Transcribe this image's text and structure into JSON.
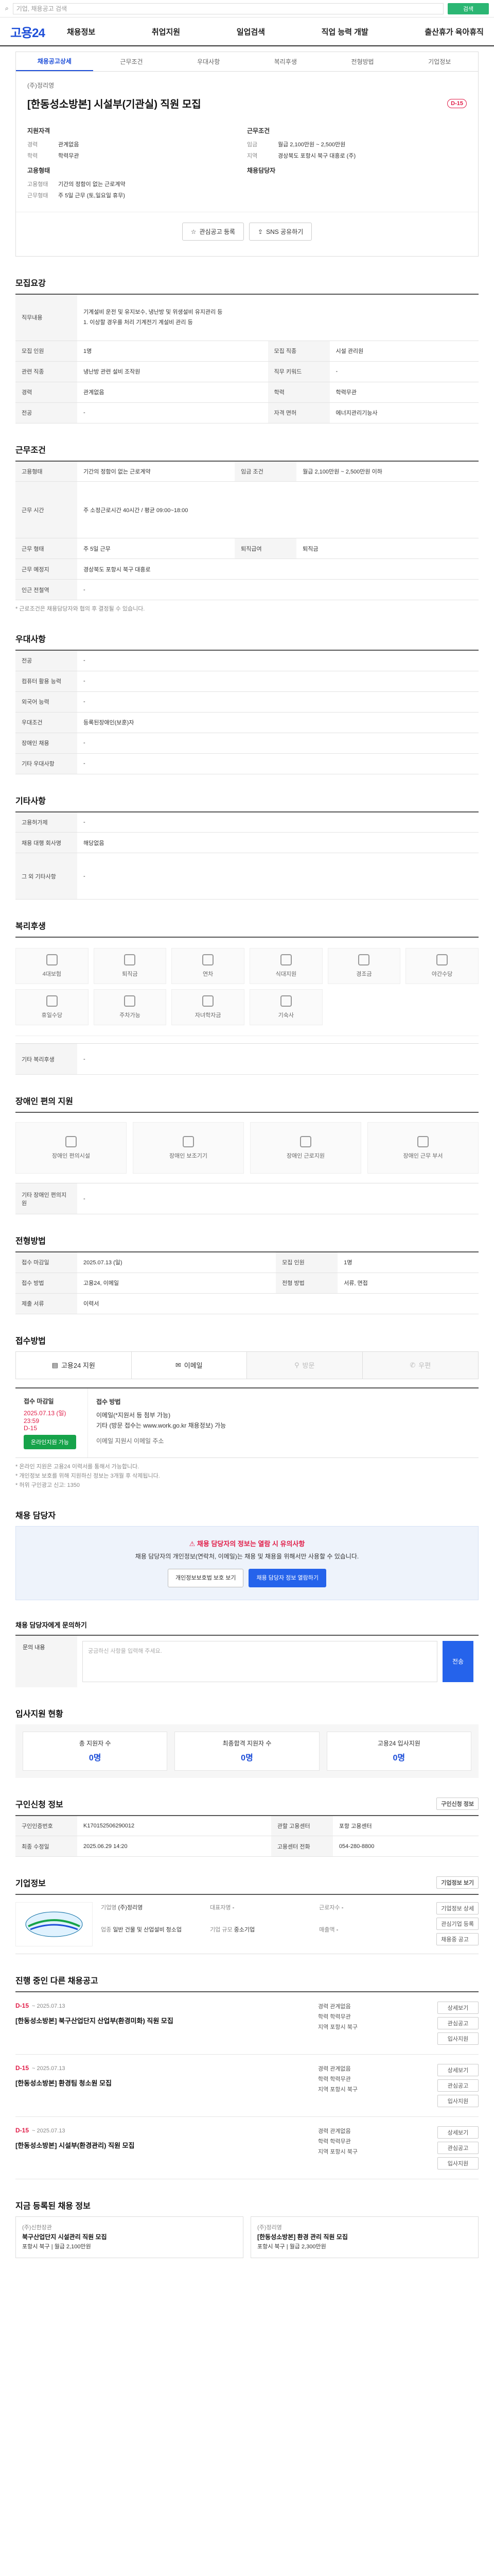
{
  "search": {
    "placeholder": "기업, 채용공고 검색",
    "button": "검색"
  },
  "gnb": {
    "logo": "고용24",
    "menu": [
      "채용정보",
      "취업지원",
      "일업검색",
      "직업 능력 개발",
      "출산휴가 육아휴직"
    ]
  },
  "tabs": [
    "채용공고상세",
    "근무조건",
    "우대사항",
    "복리후생",
    "전형방법",
    "기업정보"
  ],
  "title": {
    "company": "(주)정리영",
    "heading": "[한동성소방본] 시설부(기관실) 직원 모집",
    "dday": "D-15"
  },
  "summary": {
    "left_title": "지원자격",
    "left": [
      {
        "k": "경력",
        "v": "관계없음"
      },
      {
        "k": "학력",
        "v": "학력무관"
      }
    ],
    "left2_title": "고용형태",
    "left2": [
      {
        "k": "고용형태",
        "v": "기간의 정함이 없는 근로계약"
      },
      {
        "k": "근무형태",
        "v": "주 5일 근무 (토,일요일 휴무)"
      }
    ],
    "right_title": "근무조건",
    "right": [
      {
        "k": "임금",
        "v": "월급 2,100만원 ~ 2,500만원"
      },
      {
        "k": "지역",
        "v": "경상북도 포항시 북구 대흥로 (주)"
      }
    ],
    "right2_title": "채용담당자"
  },
  "actions": {
    "apply": "관심공고 등록",
    "share": "SNS 공유하기",
    "print": "인쇄"
  },
  "jobinfo": {
    "title": "모집요강",
    "rows": [
      {
        "k": "직무내용",
        "v": "기계설비 운전 및 유지보수, 냉난방 및 위생설비 유지관리 등\n1. 이상할 경우를 처리 기계전기 계설비 관리 등"
      },
      {
        "k": "모집 직종",
        "v": "시설 관리원"
      },
      {
        "k": "관련 직종",
        "v": "냉난방 관련 설비 조작원"
      },
      {
        "k": "직무 키워드",
        "v": "-"
      },
      {
        "k": "경력",
        "v": "관계없음"
      },
      {
        "k": "학력",
        "v": "학력무관"
      },
      {
        "k": "모집 인원",
        "v": "1명"
      },
      {
        "k": "전공",
        "v": "-"
      },
      {
        "k": "자격 면허",
        "v": "에너지관리기능사"
      }
    ]
  },
  "conditions": {
    "title": "근무조건",
    "rows": [
      {
        "k": "고용형태",
        "v": "기간의 정함이 없는 근로계약"
      },
      {
        "k": "임금 조건",
        "v": "월급 2,100만원 ~ 2,500만원 이하"
      },
      {
        "k": "근무 시간",
        "v": "주 소정근로시간 40시간 / 평균 09:00~18:00"
      },
      {
        "k": "근무 형태",
        "v": "주 5일 근무"
      },
      {
        "k": "근무 예정지",
        "v": "경상북도 포항시 북구 대흥로"
      },
      {
        "k": "인근 전철역",
        "v": "-"
      },
      {
        "k": "퇴직급여",
        "v": "퇴직금"
      }
    ],
    "note": "* 근로조건은 채용담당자와 협의 후 결정될 수 있습니다."
  },
  "prefer": {
    "title": "우대사항",
    "rows": [
      {
        "k": "전공",
        "v": "-"
      },
      {
        "k": "컴퓨터 활용 능력",
        "v": "-"
      },
      {
        "k": "외국어 능력",
        "v": "-"
      },
      {
        "k": "우대조건",
        "v": "등록된장애인(보훈)자"
      },
      {
        "k": "장애인 채용",
        "v": "-"
      },
      {
        "k": "기타 우대사항",
        "v": "-"
      }
    ]
  },
  "etc": {
    "title": "기타사항",
    "rows": [
      {
        "k": "고용허가제",
        "v": "-"
      },
      {
        "k": "채용 대행 회사명",
        "v": "해당없음"
      },
      {
        "k": "그 외 기타사항",
        "v": "-"
      }
    ]
  },
  "welfare": {
    "title": "복리후생",
    "items": [
      "4대보험",
      "퇴직금",
      "연차",
      "식대지원",
      "경조금",
      "야간수당",
      "휴일수당",
      "주차가능",
      "자녀학자금",
      "기숙사"
    ],
    "extra": {
      "k": "기타 복리후생",
      "v": "-"
    }
  },
  "disability": {
    "title": "장애인 편의 지원",
    "items": [
      "장애인 편의시설",
      "장애인 보조기기",
      "장애인 근로지원",
      "장애인 근무 부서"
    ],
    "extra": {
      "k": "기타 장애인 편의지원",
      "v": "-"
    }
  },
  "selection": {
    "title": "전형방법",
    "rows": [
      {
        "k": "접수 마감일",
        "v": "2025.07.13 (일)"
      },
      {
        "k": "모집 인원",
        "v": "1명"
      },
      {
        "k": "접수 방법",
        "v": "고용24, 이메일"
      },
      {
        "k": "전형 방법",
        "v": "서류, 면접"
      },
      {
        "k": "제출 서류",
        "v": "이력서"
      }
    ]
  },
  "apply": {
    "title": "접수방법",
    "buttons": [
      "고용24 지원",
      "이메일",
      "방문",
      "우편"
    ],
    "deadline_label": "접수 마감일",
    "deadline": "2025.07.13 (일) 23:59",
    "dday": "D-15",
    "howto_label": "접수 방법",
    "howto": "이메일(*지원서 등 첨부 가능)\n기타 (방문 접수는 www.work.go.kr 채용정보) 가능",
    "email_label": "이메일 지원시 이메일 주소",
    "apply_btn": "온라인지원 가능",
    "notes": [
      "* 온라인 지원은 고용24 이력서를 통해서 가능합니다.",
      "* 개인정보 보호를 위해 지원하신 정보는 3개월 후 삭제됩니다.",
      "* 허위 구인광고 신고: 1350"
    ]
  },
  "manager": {
    "title": "채용 담당자",
    "alert": "채용 담당자의 정보는 열람 시 유의사항",
    "desc": "채용 담당자의 개인정보(연락처, 이메일)는 채용 및 채용을 위해서만 사용할 수 있습니다.",
    "btn1": "개인정보보호법 보호 보기",
    "btn2": "채용 담당자 정보 열람하기"
  },
  "inquiry": {
    "title": "채용 담당자에게 문의하기",
    "label": "문의 내용",
    "placeholder": "궁금하신 사항을 입력해 주세요.",
    "send": "전송"
  },
  "stats": {
    "title": "입사지원 현황",
    "items": [
      {
        "label": "총 지원자 수",
        "value": "0명"
      },
      {
        "label": "최종합격 지원자 수",
        "value": "0명"
      },
      {
        "label": "고용24 입사지원",
        "value": "0명"
      }
    ]
  },
  "posting": {
    "title": "구인신청 정보",
    "btn": "구인신청 정보",
    "rows": [
      {
        "k": "구인인증번호",
        "v": "K170152506290012"
      },
      {
        "k": "최종 수정일",
        "v": "2025.06.29 14:20"
      },
      {
        "k": "관할 고용센터",
        "v": "포항 고용센터"
      },
      {
        "k": "고용센터 전화",
        "v": "054-280-8800"
      }
    ]
  },
  "company": {
    "title": "기업정보",
    "more": "기업정보 보기",
    "rows": [
      {
        "k": "기업명",
        "v": "(주)정리영"
      },
      {
        "k": "업종",
        "v": "일반 건물 및 산업설비 청소업"
      },
      {
        "k": "대표자명",
        "v": "-"
      },
      {
        "k": "기업 규모",
        "v": "중소기업"
      },
      {
        "k": "근로자수",
        "v": "-"
      },
      {
        "k": "매출액",
        "v": "-"
      }
    ],
    "btns": [
      "기업정보 상세",
      "관심기업 등록",
      "채용중 공고"
    ]
  },
  "other_jobs": {
    "title": "진행 중인 다른 채용공고",
    "items": [
      {
        "dday": "D-15",
        "date": "~ 2025.07.13",
        "title": "[한동성소방본] 북구산업단지 산업부(환경미화) 직원 모집",
        "m": [
          "경력 관계없음",
          "학력 학력무관",
          "지역 포항시 북구"
        ]
      },
      {
        "dday": "D-15",
        "date": "~ 2025.07.13",
        "title": "[한동성소방본] 환경팀 청소원 모집",
        "m": [
          "경력 관계없음",
          "학력 학력무관",
          "지역 포항시 북구"
        ]
      },
      {
        "dday": "D-15",
        "date": "~ 2025.07.13",
        "title": "[한동성소방본] 시설부(환경관리) 직원 모집",
        "m": [
          "경력 관계없음",
          "학력 학력무관",
          "지역 포항시 북구"
        ]
      }
    ],
    "btns": [
      "상세보기",
      "관심공고",
      "입사지원"
    ]
  },
  "recent": {
    "title": "지금 등록된 채용 정보",
    "items": [
      {
        "company": "(주)신한장관",
        "title": "북구산업단지 시설관리 직원 모집",
        "m": "포항시 북구 | 월급 2,100만원"
      },
      {
        "company": "(주)정리영",
        "title": "[한동성소방본] 환경 관리 직원 모집",
        "m": "포항시 북구 | 월급 2,300만원"
      }
    ]
  }
}
